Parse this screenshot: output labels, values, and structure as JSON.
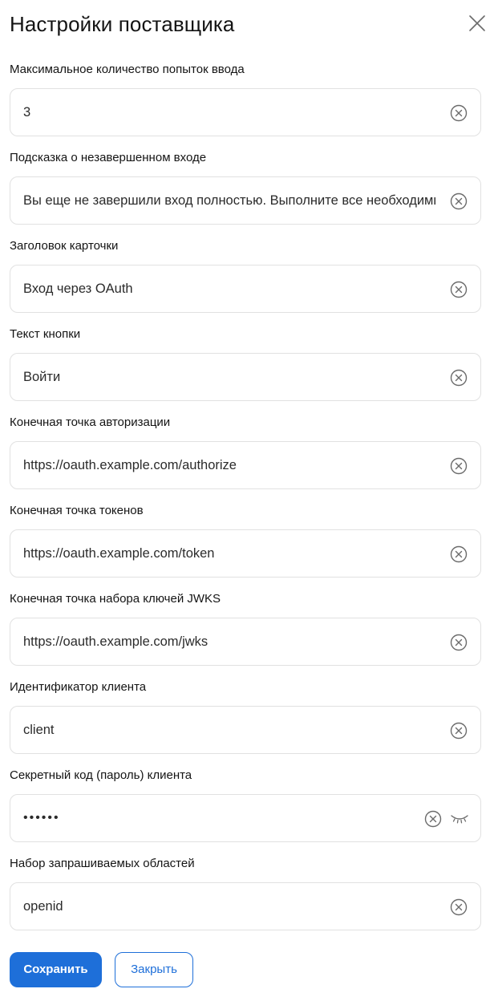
{
  "dialog": {
    "title": "Настройки поставщика",
    "close_icon": "close-icon"
  },
  "fields": [
    {
      "label": "Максимальное количество попыток ввода",
      "value": "3"
    },
    {
      "label": "Подсказка о незавершенном входе",
      "value": "Вы еще не завершили вход полностью. Выполните все необходимые шаги"
    },
    {
      "label": "Заголовок карточки",
      "value": "Вход через OAuth"
    },
    {
      "label": "Текст кнопки",
      "value": "Войти"
    },
    {
      "label": "Конечная точка авторизации",
      "value": "https://oauth.example.com/authorize"
    },
    {
      "label": "Конечная точка токенов",
      "value": "https://oauth.example.com/token"
    },
    {
      "label": "Конечная точка набора ключей JWKS",
      "value": "https://oauth.example.com/jwks"
    },
    {
      "label": "Идентификатор клиента",
      "value": "client"
    },
    {
      "label": "Секретный код (пароль) клиента",
      "value": "••••••"
    },
    {
      "label": "Набор запрашиваемых областей",
      "value": "openid"
    }
  ],
  "icons": {
    "clear": "clear-circle-x-icon",
    "password_toggle": "eye-closed-icon"
  },
  "actions": {
    "save_label": "Сохранить",
    "close_label": "Закрыть"
  },
  "colors": {
    "accent": "#1e6fd9",
    "border": "#e1e1e1",
    "icon": "#6b6b6b"
  }
}
